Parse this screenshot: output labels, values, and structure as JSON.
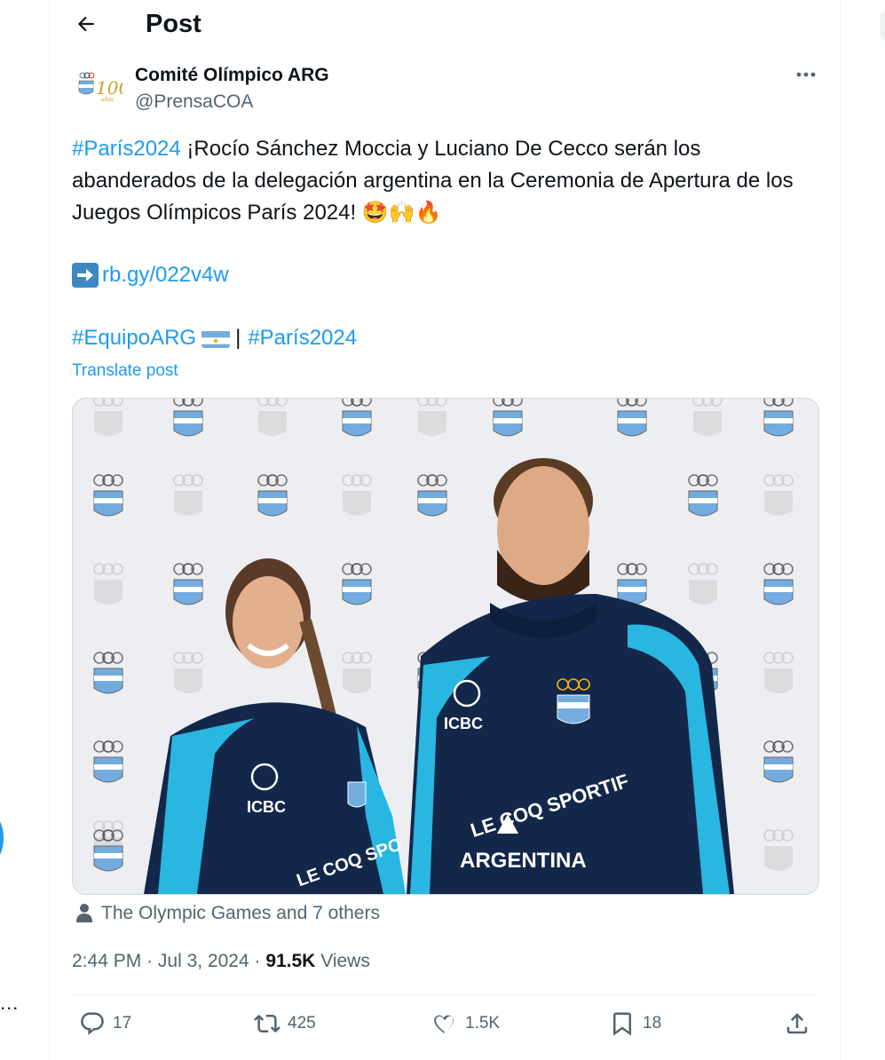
{
  "header": {
    "title": "Post"
  },
  "author": {
    "name": "Comité Olímpico ARG",
    "handle": "@PrensaCOA"
  },
  "post": {
    "tag1": "#París2024",
    "text": " ¡Rocío Sánchez Moccia y Luciano De Cecco serán los abanderados de la delegación argentina en la Ceremonia de Apertura de los Juegos Olímpicos París 2024! 🤩🙌🔥",
    "link": "rb.gy/022v4w",
    "tag2": "#EquipoARG",
    "separator": "|",
    "tag3": "#París2024",
    "translate": "Translate post"
  },
  "media": {
    "tagged": "The Olympic Games and 7 others"
  },
  "meta": {
    "time": "2:44 PM",
    "date": "Jul 3, 2024",
    "views_count": "91.5K",
    "views_label": "Views"
  },
  "actions": {
    "replies": "17",
    "reposts": "425",
    "likes": "1.5K",
    "bookmarks": "18"
  },
  "background": {
    "left_dots": "..."
  },
  "colors": {
    "accent": "#1d9bf0",
    "text": "#0f1419",
    "muted": "#536471",
    "border": "#eff3f4"
  },
  "icons": [
    "back-arrow-icon",
    "more-icon",
    "arrow-right-icon",
    "argentina-flag-icon",
    "user-icon",
    "reply-icon",
    "repost-icon",
    "like-icon",
    "bookmark-icon",
    "share-icon"
  ]
}
